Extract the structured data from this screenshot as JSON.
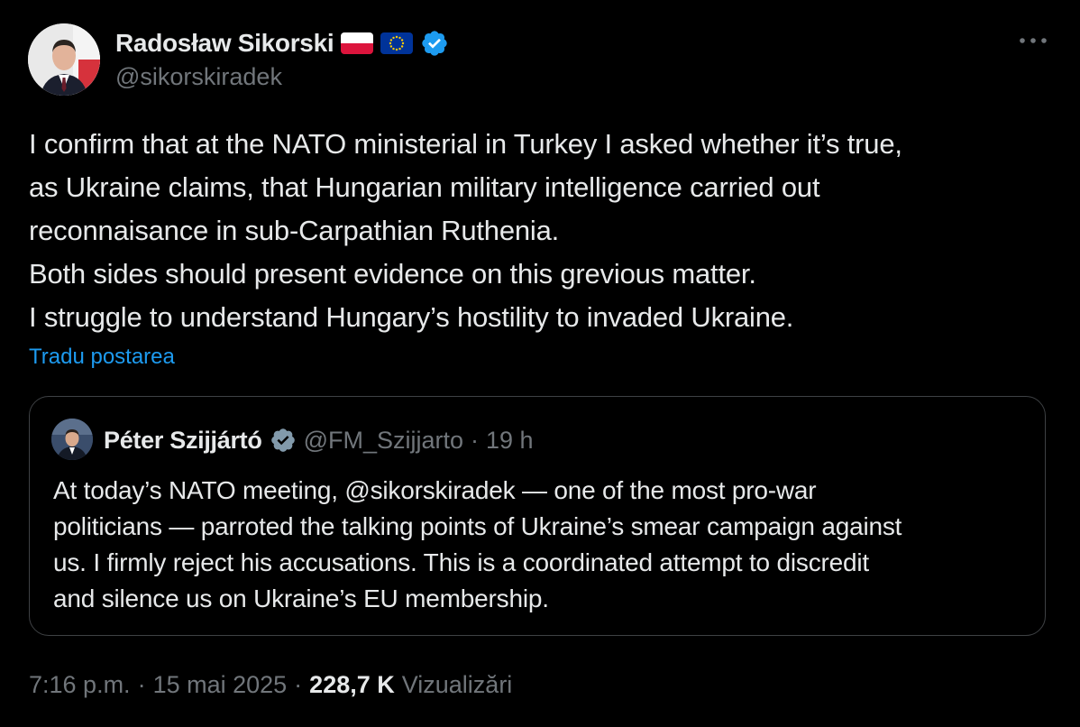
{
  "author": {
    "display_name": "Radosław Sikorski",
    "handle": "@sikorskiradek",
    "flags": [
      "flag-poland-icon",
      "flag-eu-icon"
    ],
    "verified_icon": "verified-badge-icon"
  },
  "tweet": {
    "lines": [
      "I confirm that at the NATO ministerial in Turkey I asked whether it’s true,",
      "as Ukraine claims, that Hungarian military intelligence carried out",
      "reconnaisance in sub-Carpathian Ruthenia.",
      "Both sides should present evidence on this grevious matter.",
      "I struggle to understand Hungary’s hostility to invaded Ukraine."
    ],
    "translate_label": "Tradu postarea"
  },
  "quote": {
    "display_name": "Péter Szijjártó",
    "handle": "@FM_Szijjarto",
    "separator": "·",
    "time": "19 h",
    "lines": [
      "At today’s NATO meeting, @sikorskiradek — one of the most pro-war",
      "politicians — parroted the talking points of Ukraine’s smear campaign against",
      "us. I firmly reject his accusations. This is a coordinated attempt to discredit",
      "and silence us on Ukraine’s EU membership."
    ]
  },
  "footer": {
    "time": "7:16 p.m.",
    "sep1": "·",
    "date": "15 mai 2025",
    "sep2": "·",
    "views_count": "228,7 K",
    "views_label": "Vizualizări"
  },
  "colors": {
    "background": "#000000",
    "text_primary": "#e7e9ea",
    "text_secondary": "#71767b",
    "link": "#1d9bf0",
    "border": "#3e4144",
    "verified": "#1d9bf0"
  }
}
